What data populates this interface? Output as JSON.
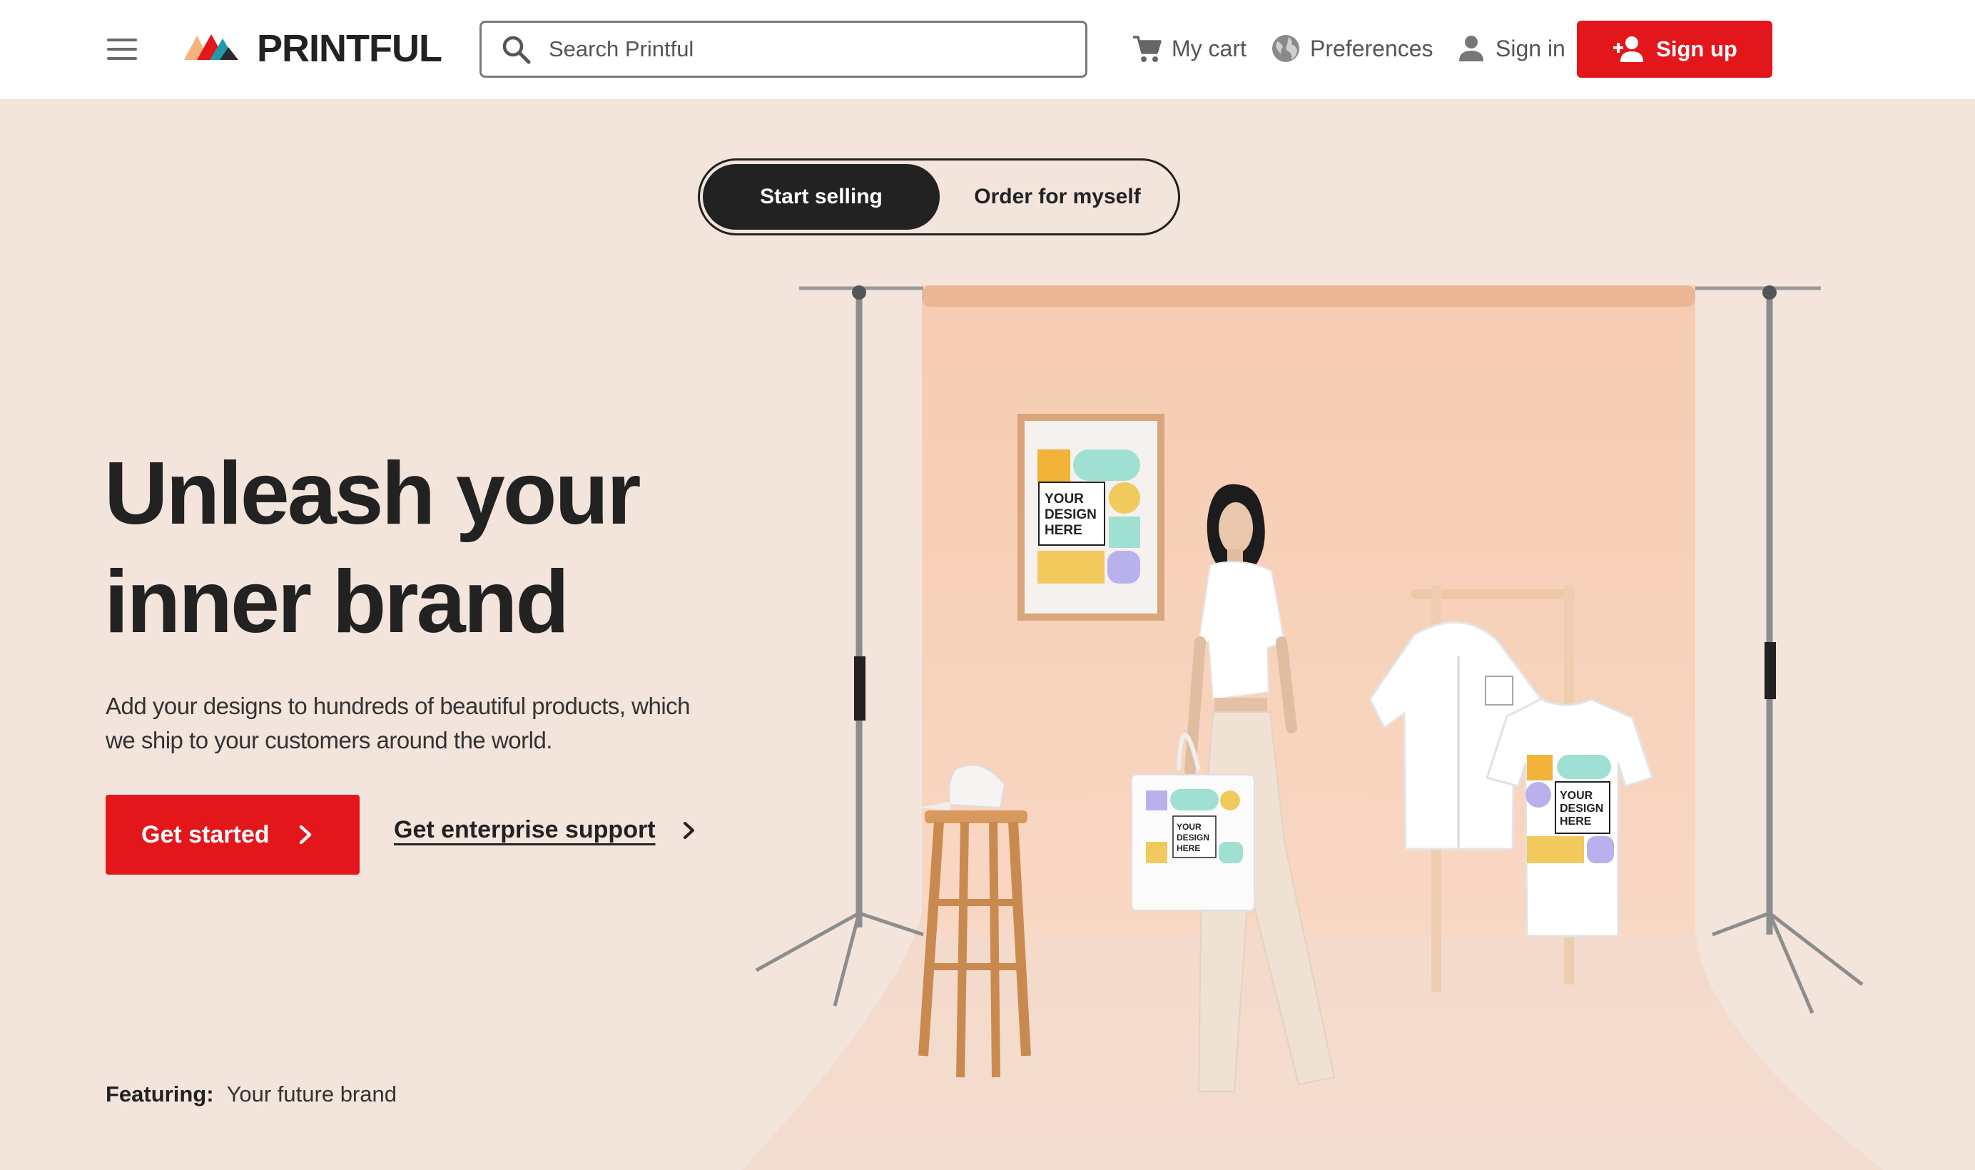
{
  "header": {
    "logo_text": "PRINTFUL",
    "search_placeholder": "Search Printful",
    "nav": {
      "cart": "My cart",
      "preferences": "Preferences",
      "sign_in": "Sign in",
      "sign_up": "Sign up"
    }
  },
  "toggle": {
    "options": [
      "Start selling",
      "Order for myself"
    ],
    "active": "Start selling"
  },
  "hero": {
    "title_line1": "Unleash your",
    "title_line2": "inner brand",
    "subtitle_line1": "Add your designs to hundreds of beautiful products, which",
    "subtitle_line2": "we ship to your customers around the world.",
    "cta": "Get started",
    "secondary_link": "Get enterprise support"
  },
  "featuring": {
    "label": "Featuring:",
    "value": "Your future brand"
  },
  "mockup_text": {
    "line1": "YOUR",
    "line2": "DESIGN",
    "line3": "HERE"
  },
  "colors": {
    "brand_red": "#e3161b",
    "hero_bg": "#f3e4dc",
    "dark": "#222222"
  },
  "icons": {
    "menu": "hamburger-icon",
    "search": "search-icon",
    "cart": "cart-icon",
    "preferences": "globe-icon",
    "sign_in": "person-icon",
    "sign_up": "person-add-icon",
    "chevron": "chevron-right-icon"
  }
}
